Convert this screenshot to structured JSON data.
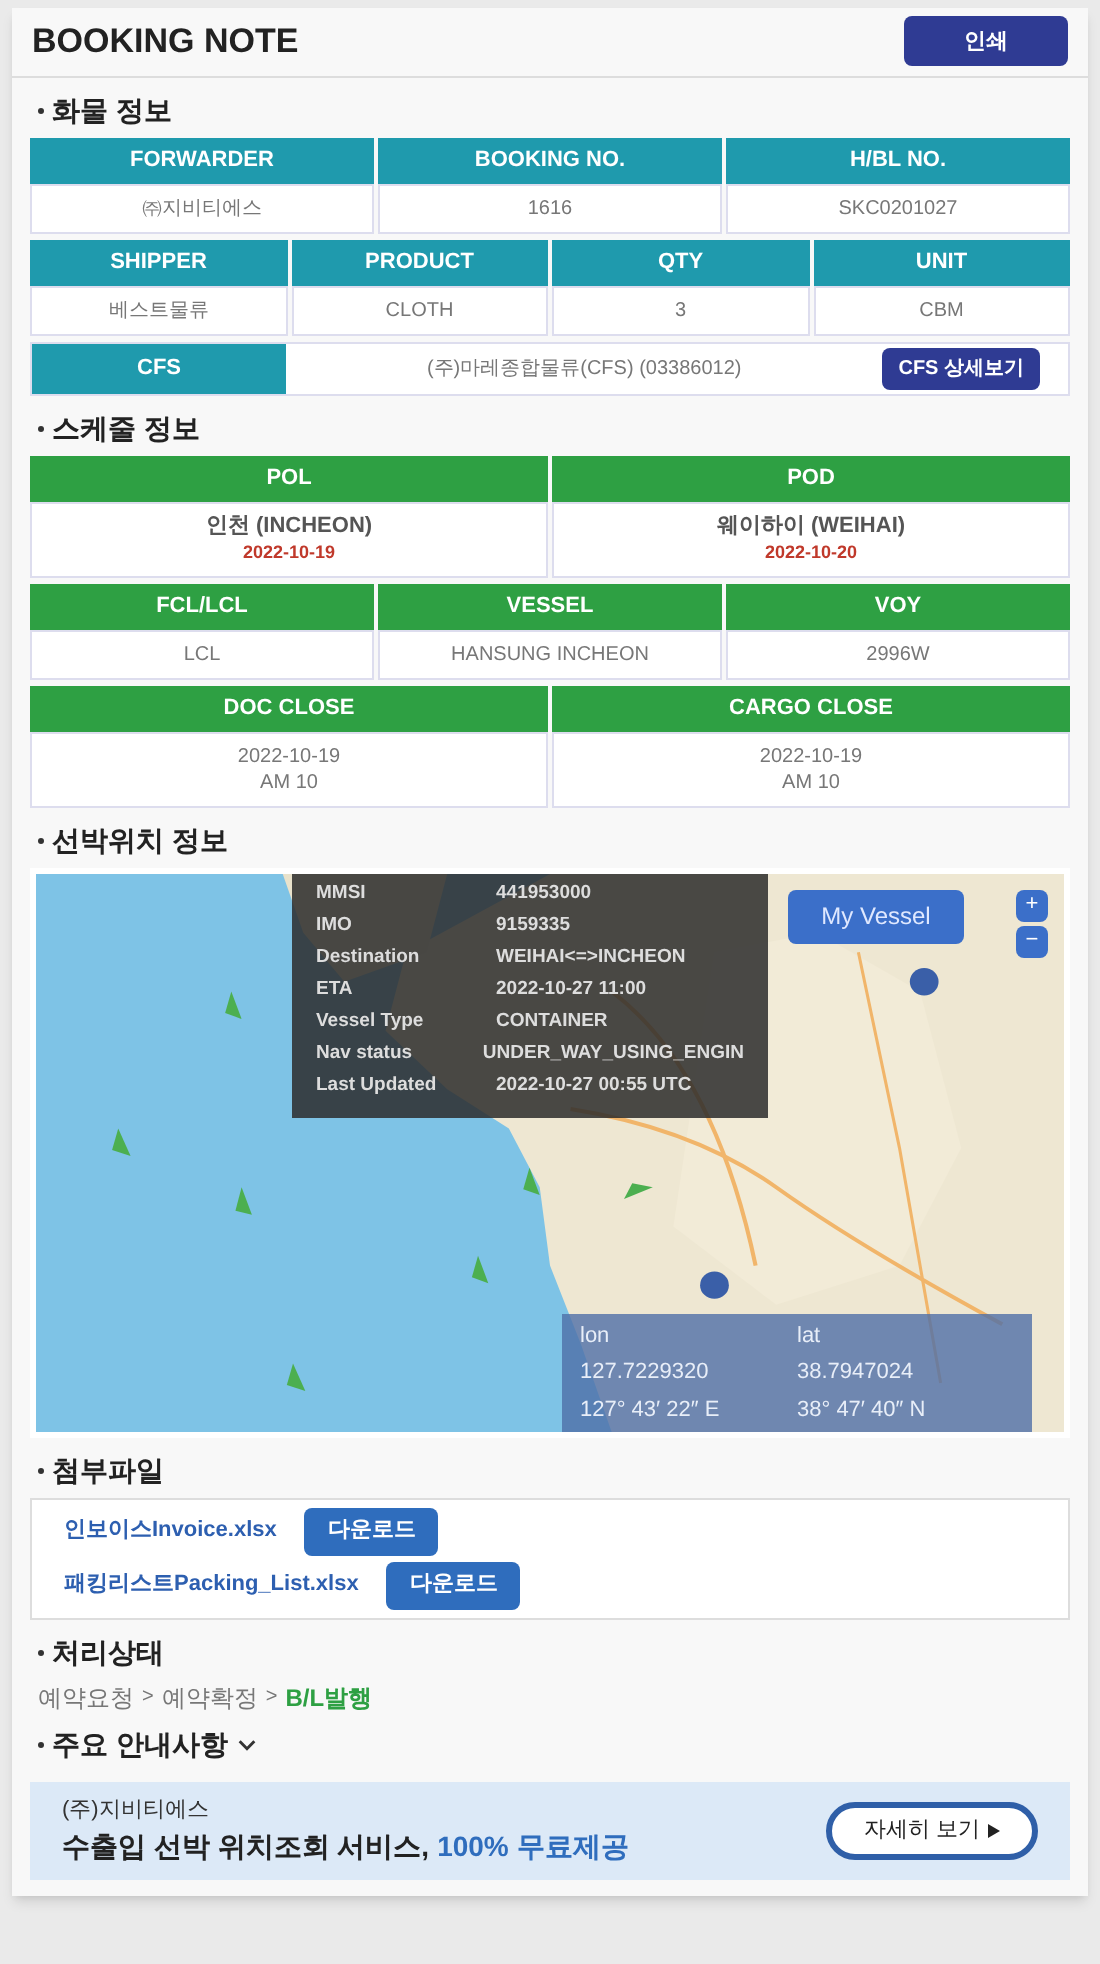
{
  "header": {
    "title": "BOOKING NOTE",
    "print_button": "인쇄"
  },
  "cargo": {
    "title": "화물 정보",
    "tables": [
      {
        "cells": [
          {
            "header": "FORWARDER",
            "value": "㈜지비티에스"
          },
          {
            "header": "BOOKING NO.",
            "value": "1616"
          },
          {
            "header": "H/BL NO.",
            "value": "SKC0201027"
          }
        ]
      },
      {
        "cells": [
          {
            "header": "SHIPPER",
            "value": "베스트물류"
          },
          {
            "header": "PRODUCT",
            "value": "CLOTH"
          },
          {
            "header": "QTY",
            "value": "3"
          },
          {
            "header": "UNIT",
            "value": "CBM"
          }
        ]
      }
    ],
    "cfs": {
      "label": "CFS",
      "value": "(주)마레종합물류(CFS) (03386012)",
      "button": "CFS 상세보기"
    }
  },
  "schedule": {
    "title": "스케줄 정보",
    "tables": [
      {
        "cells": [
          {
            "header": "POL",
            "value": "인천 (INCHEON)",
            "date": "2022-10-19"
          },
          {
            "header": "POD",
            "value": "웨이하이 (WEIHAI)",
            "date": "2022-10-20"
          }
        ]
      },
      {
        "cells": [
          {
            "header": "FCL/LCL",
            "value": "LCL"
          },
          {
            "header": "VESSEL",
            "value": "HANSUNG INCHEON"
          },
          {
            "header": "VOY",
            "value": "2996W"
          }
        ]
      },
      {
        "cells": [
          {
            "header": "DOC CLOSE",
            "value": "2022-10-19",
            "time": "AM 10"
          },
          {
            "header": "CARGO CLOSE",
            "value": "2022-10-19",
            "time": "AM 10"
          }
        ]
      }
    ]
  },
  "vessel_map": {
    "title": "선박위치 정보",
    "info": [
      {
        "label": "MMSI",
        "value": "441953000"
      },
      {
        "label": "IMO",
        "value": "9159335"
      },
      {
        "label": "Destination",
        "value": "WEIHAI<=>INCHEON"
      },
      {
        "label": "ETA",
        "value": "2022-10-27 11:00"
      },
      {
        "label": "Vessel Type",
        "value": "CONTAINER"
      },
      {
        "label": "Nav status",
        "value": "UNDER_WAY_USING_ENGIN"
      },
      {
        "label": "Last Updated",
        "value": "2022-10-27 00:55 UTC"
      }
    ],
    "my_vessel_button": "My Vessel",
    "zoom_in": "+",
    "zoom_out": "−",
    "coords": {
      "lon_label": "lon",
      "lat_label": "lat",
      "lon": "127.7229320",
      "lat": "38.7947024",
      "lon_dms": "127° 43′ 22″ E",
      "lat_dms": "38° 47′ 40″ N"
    }
  },
  "attachments": {
    "title": "첨부파일",
    "files": [
      {
        "name": "인보이스Invoice.xlsx",
        "button": "다운로드"
      },
      {
        "name": "패킹리스트Packing_List.xlsx",
        "button": "다운로드"
      }
    ]
  },
  "status": {
    "title": "처리상태",
    "steps": [
      {
        "kind": "step",
        "label": "예약요청",
        "selected": false
      },
      {
        "kind": "separator",
        "label": ">"
      },
      {
        "kind": "step",
        "label": "예약확정",
        "selected": false
      },
      {
        "kind": "separator",
        "label": ">"
      },
      {
        "kind": "step",
        "label": "B/L발행",
        "selected": true
      }
    ]
  },
  "notice": {
    "title": "주요 안내사항",
    "expanded": false
  },
  "banner": {
    "company": "(주)지비티에스",
    "message": "수출입 선박 위치조회 서비스,",
    "highlight": "100% 무료제공",
    "button": "자세히 보기"
  }
}
